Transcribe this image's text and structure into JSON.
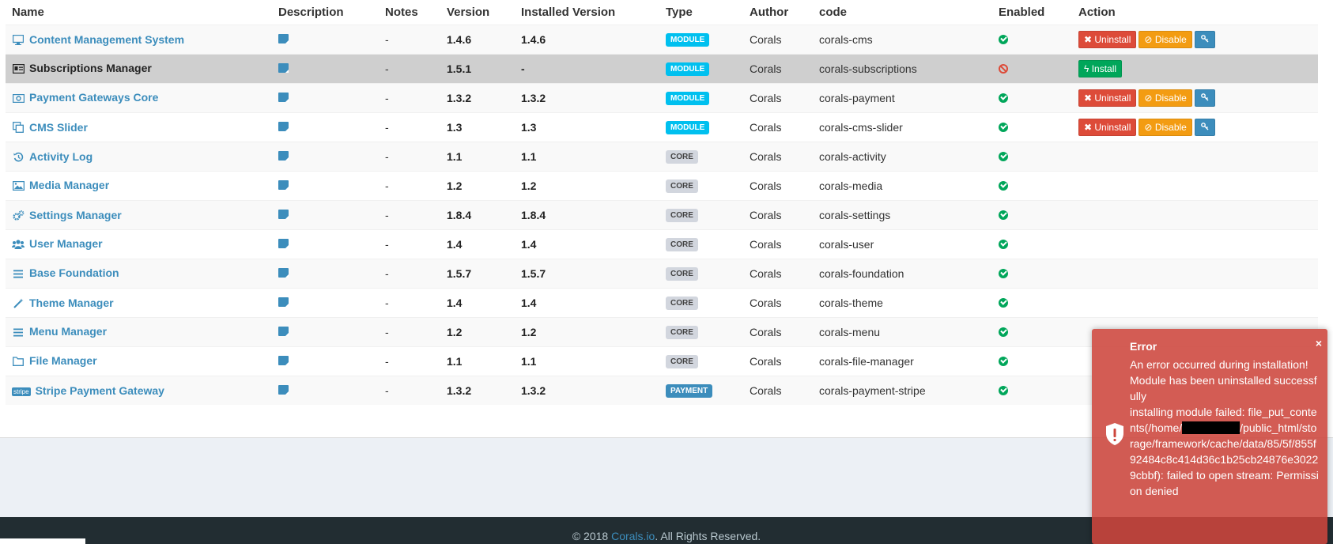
{
  "columns": [
    "Name",
    "Description",
    "Notes",
    "Version",
    "Installed Version",
    "Type",
    "Author",
    "code",
    "Enabled",
    "Action"
  ],
  "rows": [
    {
      "icon": "desktop-icon",
      "name": "Content Management System",
      "notes": "-",
      "version": "1.4.6",
      "installed": "1.4.6",
      "type": "MODULE",
      "author": "Corals",
      "code": "corals-cms",
      "enabled": true
    },
    {
      "icon": "id-card-icon",
      "name": "Subscriptions Manager",
      "notes": "-",
      "version": "1.5.1",
      "installed": "-",
      "type": "MODULE",
      "author": "Corals",
      "code": "corals-subscriptions",
      "enabled": false
    },
    {
      "icon": "money-icon",
      "name": "Payment Gateways Core",
      "notes": "-",
      "version": "1.3.2",
      "installed": "1.3.2",
      "type": "MODULE",
      "author": "Corals",
      "code": "corals-payment",
      "enabled": true
    },
    {
      "icon": "clone-icon",
      "name": "CMS Slider",
      "notes": "-",
      "version": "1.3",
      "installed": "1.3",
      "type": "MODULE",
      "author": "Corals",
      "code": "corals-cms-slider",
      "enabled": true
    },
    {
      "icon": "history-icon",
      "name": "Activity Log",
      "notes": "-",
      "version": "1.1",
      "installed": "1.1",
      "type": "CORE",
      "author": "Corals",
      "code": "corals-activity",
      "enabled": true
    },
    {
      "icon": "image-icon",
      "name": "Media Manager",
      "notes": "-",
      "version": "1.2",
      "installed": "1.2",
      "type": "CORE",
      "author": "Corals",
      "code": "corals-media",
      "enabled": true
    },
    {
      "icon": "cogs-icon",
      "name": "Settings Manager",
      "notes": "-",
      "version": "1.8.4",
      "installed": "1.8.4",
      "type": "CORE",
      "author": "Corals",
      "code": "corals-settings",
      "enabled": true
    },
    {
      "icon": "users-icon",
      "name": "User Manager",
      "notes": "-",
      "version": "1.4",
      "installed": "1.4",
      "type": "CORE",
      "author": "Corals",
      "code": "corals-user",
      "enabled": true
    },
    {
      "icon": "bars-icon",
      "name": "Base Foundation",
      "notes": "-",
      "version": "1.5.7",
      "installed": "1.5.7",
      "type": "CORE",
      "author": "Corals",
      "code": "corals-foundation",
      "enabled": true
    },
    {
      "icon": "magic-wand-icon",
      "name": "Theme Manager",
      "notes": "-",
      "version": "1.4",
      "installed": "1.4",
      "type": "CORE",
      "author": "Corals",
      "code": "corals-theme",
      "enabled": true
    },
    {
      "icon": "bars-icon",
      "name": "Menu Manager",
      "notes": "-",
      "version": "1.2",
      "installed": "1.2",
      "type": "CORE",
      "author": "Corals",
      "code": "corals-menu",
      "enabled": true
    },
    {
      "icon": "folder-icon",
      "name": "File Manager",
      "notes": "-",
      "version": "1.1",
      "installed": "1.1",
      "type": "CORE",
      "author": "Corals",
      "code": "corals-file-manager",
      "enabled": true
    },
    {
      "icon": "stripe-icon",
      "name": "Stripe Payment Gateway",
      "notes": "-",
      "version": "1.3.2",
      "installed": "1.3.2",
      "type": "PAYMENT",
      "author": "Corals",
      "code": "corals-payment-stripe",
      "enabled": true
    }
  ],
  "actions": {
    "uninstall": "Uninstall",
    "disable": "Disable",
    "install": "Install",
    "stripe_icon_text": "stripe"
  },
  "toast": {
    "title": "Error",
    "close": "×",
    "line1": "An error occurred during installation!",
    "line2": "Module has been uninstalled successfully",
    "line3_prefix": "installing module failed: file_put_contents(/home/",
    "line3_suffix": "/public_html/storage/framework/cache/data/85/5f/855f92484c8c414d36c1b25cb24876e30229cbbf): failed to open stream: Permission denied"
  },
  "footer": {
    "prefix": "© 2018 ",
    "link": "Corals.io",
    "suffix": ". All Rights Reserved."
  },
  "colors": {
    "link": "#3c8dbc",
    "danger": "#dd4b39",
    "warning": "#f39c12",
    "success": "#00a65a",
    "module_badge": "#00c0ef",
    "core_badge": "#d2d6de"
  }
}
